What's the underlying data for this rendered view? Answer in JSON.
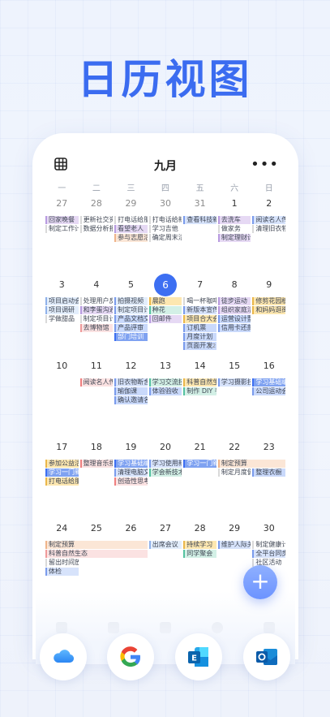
{
  "hero": {
    "title": "日历视图"
  },
  "calendar": {
    "month": "九月",
    "more": "•••",
    "weekdays": [
      "一",
      "二",
      "三",
      "四",
      "五",
      "六",
      "日"
    ],
    "weeks": [
      {
        "days": [
          {
            "n": "27",
            "muted": true
          },
          {
            "n": "28",
            "muted": true
          },
          {
            "n": "29",
            "muted": true
          },
          {
            "n": "30",
            "muted": true
          },
          {
            "n": "31",
            "muted": true
          },
          {
            "n": "1"
          },
          {
            "n": "2"
          }
        ],
        "events": [
          {
            "d": 0,
            "span": 1,
            "row": 0,
            "t": "回家晚餐",
            "c": "#e6d9f4",
            "b": "#b89be0"
          },
          {
            "d": 1,
            "span": 1,
            "row": 0,
            "t": "更新社交资料",
            "c": "#fff",
            "b": "#d9d9d9"
          },
          {
            "d": 2,
            "span": 1,
            "row": 0,
            "t": "打电话给朋友",
            "c": "#fff",
            "b": "#d9d9d9"
          },
          {
            "d": 3,
            "span": 1,
            "row": 0,
            "t": "打电话给新朋友",
            "c": "#fff",
            "b": "#d9d9d9"
          },
          {
            "d": 4,
            "span": 1,
            "row": 0,
            "t": "查看科技新闻",
            "c": "#d7e3fb",
            "b": "#7a9bec"
          },
          {
            "d": 5,
            "span": 1,
            "row": 0,
            "t": "去洗车",
            "c": "#e6d9f4",
            "b": "#b89be0"
          },
          {
            "d": 6,
            "span": 1,
            "row": 0,
            "t": "阅读名人传记",
            "c": "#d7e3fb",
            "b": "#7a9bec"
          },
          {
            "d": 0,
            "span": 1,
            "row": 1,
            "t": "制定工作计划",
            "c": "#fff",
            "b": "#d9d9d9"
          },
          {
            "d": 1,
            "span": 1,
            "row": 1,
            "t": "数据分析报告",
            "c": "#fff",
            "b": "#d9d9d9"
          },
          {
            "d": 2,
            "span": 1,
            "row": 1,
            "t": "看望老人",
            "c": "#e6d9f4",
            "b": "#b89be0"
          },
          {
            "d": 3,
            "span": 1,
            "row": 1,
            "t": "学习吉他",
            "c": "#fff",
            "b": "#d9d9d9"
          },
          {
            "d": 5,
            "span": 1,
            "row": 1,
            "t": "做家务",
            "c": "#fff",
            "b": "#d9d9d9"
          },
          {
            "d": 6,
            "span": 1,
            "row": 1,
            "t": "清理旧衣物",
            "c": "#fff",
            "b": "#d9d9d9"
          },
          {
            "d": 2,
            "span": 1,
            "row": 2,
            "t": "参与志愿活动",
            "c": "#fbe6d6",
            "b": "#efb48a"
          },
          {
            "d": 3,
            "span": 1,
            "row": 2,
            "t": "确定周末活动",
            "c": "#fff",
            "b": "#d9d9d9"
          },
          {
            "d": 5,
            "span": 1,
            "row": 2,
            "t": "制定理财计划",
            "c": "#e6d9f4",
            "b": "#b89be0"
          }
        ]
      },
      {
        "days": [
          {
            "n": "3"
          },
          {
            "n": "4"
          },
          {
            "n": "5"
          },
          {
            "n": "6",
            "today": true
          },
          {
            "n": "7"
          },
          {
            "n": "8"
          },
          {
            "n": "9"
          }
        ],
        "events": [
          {
            "d": 0,
            "span": 1,
            "row": 0,
            "t": "项目启动会",
            "c": "#e3eefc",
            "b": "#8fb1ea"
          },
          {
            "d": 1,
            "span": 1,
            "row": 0,
            "t": "处理用户反馈",
            "c": "#fff",
            "b": "#d9d9d9"
          },
          {
            "d": 2,
            "span": 1,
            "row": 0,
            "t": "拍摄视频",
            "c": "#e3eefc",
            "b": "#7a9bec"
          },
          {
            "d": 3,
            "span": 1,
            "row": 0,
            "t": "晨跑",
            "c": "#fde7b0",
            "b": "#eab74a"
          },
          {
            "d": 4,
            "span": 1,
            "row": 0,
            "t": "喝一杯咖啡",
            "c": "#fff",
            "b": "#d9d9d9"
          },
          {
            "d": 5,
            "span": 1,
            "row": 0,
            "t": "徒步运动",
            "c": "#e6d9f4",
            "b": "#b89be0"
          },
          {
            "d": 6,
            "span": 1,
            "row": 0,
            "t": "修剪花园植物",
            "c": "#fde7b0",
            "b": "#eab74a"
          },
          {
            "d": 0,
            "span": 1,
            "row": 1,
            "t": "项目调研",
            "c": "#e3eefc",
            "b": "#8fb1ea"
          },
          {
            "d": 1,
            "span": 1,
            "row": 1,
            "t": "和李蛋沟通",
            "c": "#e6d9f4",
            "b": "#b89be0"
          },
          {
            "d": 2,
            "span": 1,
            "row": 1,
            "t": "制定项目计划",
            "c": "#e3eefc",
            "b": "#7a9bec"
          },
          {
            "d": 3,
            "span": 1,
            "row": 1,
            "t": "种花",
            "c": "#d3f0e6",
            "b": "#54c2a0"
          },
          {
            "d": 4,
            "span": 1,
            "row": 1,
            "t": "新版本宣传",
            "c": "#d7e3fb",
            "b": "#7a9bec"
          },
          {
            "d": 5,
            "span": 1,
            "row": 1,
            "t": "组织家庭活动",
            "c": "#e6d9f4",
            "b": "#b89be0"
          },
          {
            "d": 6,
            "span": 1,
            "row": 1,
            "t": "和妈妈逛街",
            "c": "#fde7b0",
            "b": "#eab74a"
          },
          {
            "d": 0,
            "span": 1,
            "row": 2,
            "t": "学做甜品",
            "c": "#fff",
            "b": "#d9d9d9"
          },
          {
            "d": 1,
            "span": 1,
            "row": 2,
            "t": "制定项目计划",
            "c": "#fff",
            "b": "#d9d9d9"
          },
          {
            "d": 2,
            "span": 1,
            "row": 2,
            "t": "产品文档交接",
            "c": "#c9d9fb",
            "b": "#7a9bec"
          },
          {
            "d": 3,
            "span": 1,
            "row": 2,
            "t": "回邮件",
            "c": "#e6d9f4",
            "b": "#b89be0"
          },
          {
            "d": 4,
            "span": 1,
            "row": 2,
            "t": "项目合大会",
            "c": "#fde7b0",
            "b": "#eab74a"
          },
          {
            "d": 5,
            "span": 1,
            "row": 2,
            "t": "运营设计整理",
            "c": "#c9d9fb",
            "b": "#7a9bec"
          },
          {
            "d": 1,
            "span": 1,
            "row": 3,
            "t": "去博物馆",
            "c": "#fbe2e2",
            "b": "#ef9a9a"
          },
          {
            "d": 2,
            "span": 1,
            "row": 3,
            "t": "产品评审",
            "c": "#c9d9fb",
            "b": "#7a9bec"
          },
          {
            "d": 4,
            "span": 1,
            "row": 3,
            "t": "订机票",
            "c": "#c9d9fb",
            "b": "#7a9bec"
          },
          {
            "d": 5,
            "span": 1,
            "row": 3,
            "t": "信用卡还款",
            "c": "#c9d9fb",
            "b": "#7a9bec"
          },
          {
            "d": 2,
            "span": 1,
            "row": 4,
            "t": "部门培训",
            "c": "#7fa2f1",
            "b": "#3d6ff2",
            "strong": true
          },
          {
            "d": 4,
            "span": 1,
            "row": 4,
            "t": "月度计划",
            "c": "#c9d9fb",
            "b": "#7a9bec"
          },
          {
            "d": 4,
            "span": 1,
            "row": 5,
            "t": "页面开发",
            "c": "#c9d9fb",
            "b": "#7a9bec"
          }
        ],
        "more": {
          "d": 4,
          "row": 5,
          "t": "+2"
        }
      },
      {
        "days": [
          {
            "n": "10"
          },
          {
            "n": "11"
          },
          {
            "n": "12"
          },
          {
            "n": "13"
          },
          {
            "n": "14"
          },
          {
            "n": "15"
          },
          {
            "n": "16"
          }
        ],
        "events": [
          {
            "d": 1,
            "span": 1,
            "row": 0,
            "t": "阅读名人传记",
            "c": "#fbe2e2",
            "b": "#ef7f7f"
          },
          {
            "d": 2,
            "span": 1,
            "row": 0,
            "t": "旧衣物断舍离",
            "c": "#d7e3fb",
            "b": "#7a9bec"
          },
          {
            "d": 3,
            "span": 1,
            "row": 0,
            "t": "学习交流技巧",
            "c": "#d3f0e6",
            "b": "#54c2a0"
          },
          {
            "d": 4,
            "span": 1,
            "row": 0,
            "t": "科普自然生态",
            "c": "#fde7b0",
            "b": "#eab74a"
          },
          {
            "d": 5,
            "span": 1,
            "row": 0,
            "t": "学习摄影技巧",
            "c": "#d7e3fb",
            "b": "#7a9bec"
          },
          {
            "d": 6,
            "span": 1,
            "row": 0,
            "t": "学习基础编程",
            "c": "#7fa2f1",
            "b": "#3d6ff2",
            "strong": true
          },
          {
            "d": 2,
            "span": 1,
            "row": 1,
            "t": "瑜伽课",
            "c": "#c9d9fb",
            "b": "#7a9bec"
          },
          {
            "d": 3,
            "span": 1,
            "row": 1,
            "t": "体验验收",
            "c": "#c9d9fb",
            "b": "#7a9bec"
          },
          {
            "d": 4,
            "span": 1,
            "row": 1,
            "t": "制作 DIY 手工",
            "c": "#d3f0e6",
            "b": "#54c2a0"
          },
          {
            "d": 6,
            "span": 1,
            "row": 1,
            "t": "公司运动会",
            "c": "#c9d9fb",
            "b": "#7a9bec"
          },
          {
            "d": 2,
            "span": 1,
            "row": 2,
            "t": "确认邀请名单",
            "c": "#c9d9fb",
            "b": "#7a9bec"
          }
        ]
      },
      {
        "days": [
          {
            "n": "17"
          },
          {
            "n": "18"
          },
          {
            "n": "19"
          },
          {
            "n": "20"
          },
          {
            "n": "21"
          },
          {
            "n": "22"
          },
          {
            "n": "23"
          }
        ],
        "events": [
          {
            "d": 0,
            "span": 1,
            "row": 0,
            "t": "参加公益活动",
            "c": "#fde7b0",
            "b": "#eab74a"
          },
          {
            "d": 1,
            "span": 1,
            "row": 0,
            "t": "整理音乐播放",
            "c": "#fbe2e2",
            "b": "#ef7f7f"
          },
          {
            "d": 2,
            "span": 1,
            "row": 0,
            "t": "学习基础编程",
            "c": "#7fa2f1",
            "b": "#3d6ff2",
            "strong": true
          },
          {
            "d": 3,
            "span": 1,
            "row": 0,
            "t": "学习使用新软件",
            "c": "#d7e3fb",
            "b": "#7a9bec"
          },
          {
            "d": 4,
            "span": 1,
            "row": 0,
            "t": "学习一门新语言",
            "c": "#7fa2f1",
            "b": "#3d6ff2",
            "strong": true
          },
          {
            "d": 5,
            "span": 2,
            "row": 0,
            "t": "制定预算",
            "c": "#fbe6d6",
            "b": "#efb48a"
          },
          {
            "d": 0,
            "span": 1,
            "row": 1,
            "t": "学习一门新语",
            "c": "#7fa2f1",
            "b": "#3d6ff2",
            "strong": true
          },
          {
            "d": 2,
            "span": 1,
            "row": 1,
            "t": "清理电脑文件",
            "c": "#d7e3fb",
            "b": "#7a9bec"
          },
          {
            "d": 3,
            "span": 1,
            "row": 1,
            "t": "学会新技术",
            "c": "#d3f0e6",
            "b": "#54c2a0"
          },
          {
            "d": 5,
            "span": 1,
            "row": 1,
            "t": "制定月度健身计划",
            "c": "#fff",
            "b": "#d9d9d9"
          },
          {
            "d": 6,
            "span": 1,
            "row": 1,
            "t": "整理衣橱",
            "c": "#c9d9fb",
            "b": "#7a9bec"
          },
          {
            "d": 0,
            "span": 1,
            "row": 2,
            "t": "打电话给朋友",
            "c": "#fde7b0",
            "b": "#eab74a"
          },
          {
            "d": 2,
            "span": 1,
            "row": 2,
            "t": "创造性思考",
            "c": "#fbe2e2",
            "b": "#ef7f7f"
          }
        ]
      },
      {
        "days": [
          {
            "n": "24"
          },
          {
            "n": "25"
          },
          {
            "n": "26"
          },
          {
            "n": "27"
          },
          {
            "n": "28"
          },
          {
            "n": "29"
          },
          {
            "n": "30"
          }
        ],
        "events": [
          {
            "d": 0,
            "span": 3,
            "row": 0,
            "t": "制定预算",
            "c": "#fbe6d6",
            "b": "#efb48a"
          },
          {
            "d": 3,
            "span": 1,
            "row": 0,
            "t": "出席会议",
            "c": "#e3eefc",
            "b": "#8fb1ea"
          },
          {
            "d": 4,
            "span": 1,
            "row": 0,
            "t": "持续学习",
            "c": "#fde7b0",
            "b": "#eab74a"
          },
          {
            "d": 5,
            "span": 1,
            "row": 0,
            "t": "维护人际关系",
            "c": "#d7e3fb",
            "b": "#7a9bec"
          },
          {
            "d": 6,
            "span": 1,
            "row": 0,
            "t": "制定健康计划",
            "c": "#fff",
            "b": "#d9d9d9"
          },
          {
            "d": 0,
            "span": 3,
            "row": 1,
            "t": "科普自然生态",
            "c": "#fbe2e2",
            "b": "#ef9a9a"
          },
          {
            "d": 4,
            "span": 1,
            "row": 1,
            "t": "同学聚会",
            "c": "#d3f0e6",
            "b": "#54c2a0"
          },
          {
            "d": 6,
            "span": 1,
            "row": 1,
            "t": "全平台同步",
            "c": "#d7e3fb",
            "b": "#7a9bec"
          },
          {
            "d": 0,
            "span": 1,
            "row": 2,
            "t": "留出时间放松",
            "c": "#fff",
            "b": "#d9d9d9"
          },
          {
            "d": 6,
            "span": 1,
            "row": 2,
            "t": "社区活动",
            "c": "#fff",
            "b": "#d9d9d9"
          },
          {
            "d": 0,
            "span": 1,
            "row": 3,
            "t": "体检",
            "c": "#d7e3fb",
            "b": "#7a9bec"
          }
        ]
      }
    ]
  },
  "fab": {
    "label": "+"
  },
  "apps": [
    "icloud-app",
    "google-app",
    "exchange-app",
    "outlook-app"
  ],
  "colors": {
    "accent": "#3d6ff2",
    "hero": "#3b6cf0"
  }
}
